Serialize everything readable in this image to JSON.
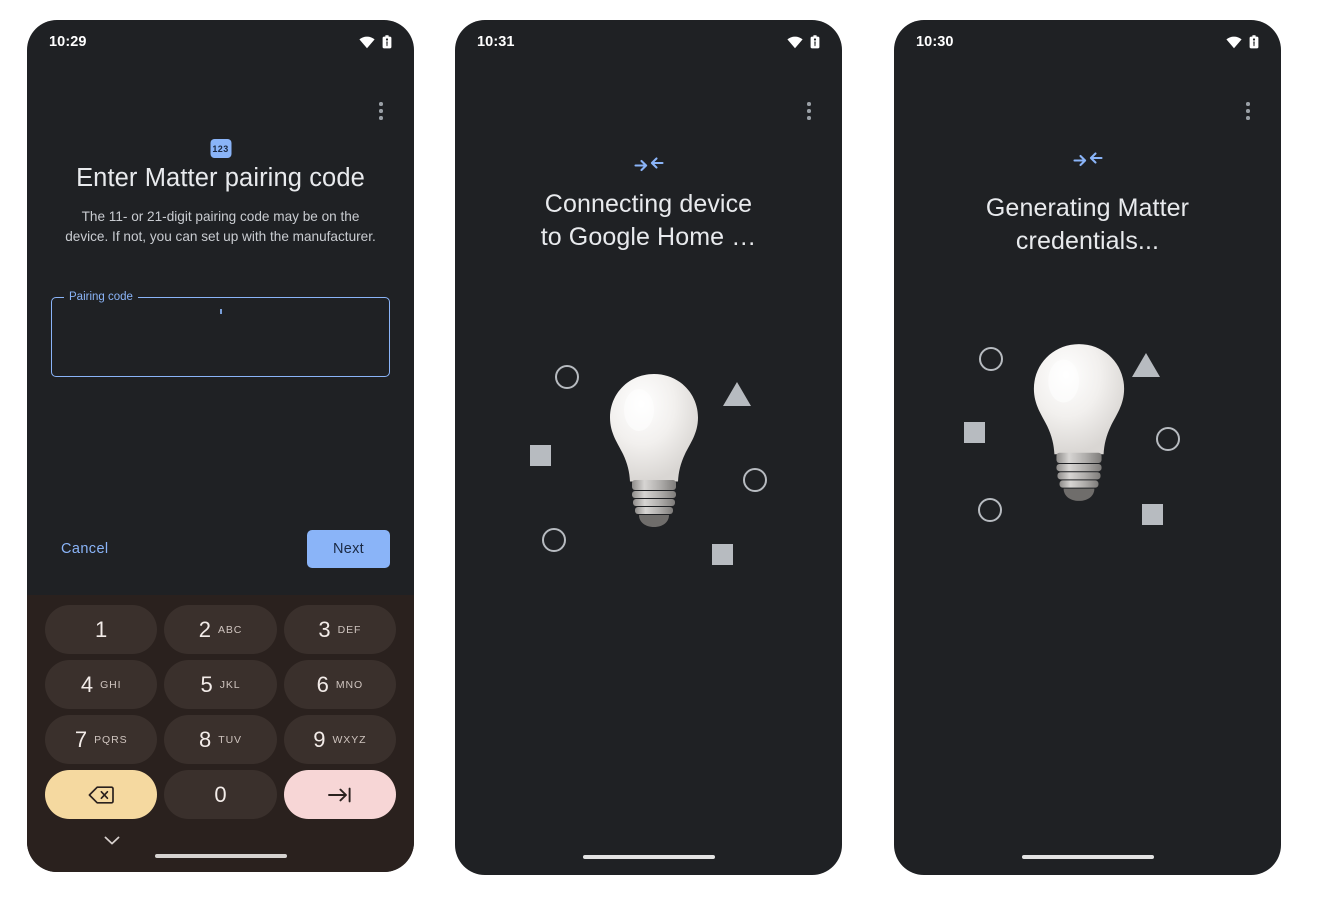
{
  "page": {
    "background": "#ffffff",
    "accent": "#8ab4f8"
  },
  "phones": [
    {
      "id": "phone1",
      "status": {
        "time": "10:29",
        "wifi_icon": "wifi-icon",
        "battery_icon": "battery-icon"
      },
      "overflow_icon": "more-vert-icon",
      "badge": {
        "icon": "numeric-123-icon",
        "label": "123",
        "color": "#8ab4f8"
      },
      "title": "Enter Matter pairing code",
      "description": "The 11- or 21-digit pairing code may be on the device. If not, you can set up with the manufacturer.",
      "field": {
        "label": "Pairing code",
        "value": "",
        "placeholder": ""
      },
      "buttons": {
        "cancel": "Cancel",
        "next": "Next"
      },
      "keyboard": {
        "collapse_icon": "chevron-down-icon",
        "keys": [
          {
            "num": "1",
            "letters": "",
            "name": "key-1",
            "kind": "num"
          },
          {
            "num": "2",
            "letters": "ABC",
            "name": "key-2",
            "kind": "num"
          },
          {
            "num": "3",
            "letters": "DEF",
            "name": "key-3",
            "kind": "num"
          },
          {
            "num": "4",
            "letters": "GHI",
            "name": "key-4",
            "kind": "num"
          },
          {
            "num": "5",
            "letters": "JKL",
            "name": "key-5",
            "kind": "num"
          },
          {
            "num": "6",
            "letters": "MNO",
            "name": "key-6",
            "kind": "num"
          },
          {
            "num": "7",
            "letters": "PQRS",
            "name": "key-7",
            "kind": "num"
          },
          {
            "num": "8",
            "letters": "TUV",
            "name": "key-8",
            "kind": "num"
          },
          {
            "num": "9",
            "letters": "WXYZ",
            "name": "key-9",
            "kind": "num"
          },
          {
            "num": "",
            "letters": "",
            "name": "key-backspace",
            "kind": "del",
            "icon": "backspace-icon",
            "color": "#f5d9a0"
          },
          {
            "num": "0",
            "letters": "",
            "name": "key-0",
            "kind": "num"
          },
          {
            "num": "",
            "letters": "",
            "name": "key-enter",
            "kind": "ent",
            "icon": "tab-next-icon",
            "color": "#f7d6d6"
          }
        ]
      }
    },
    {
      "id": "phone2",
      "status": {
        "time": "10:31",
        "wifi_icon": "wifi-icon",
        "battery_icon": "battery-icon"
      },
      "overflow_icon": "more-vert-icon",
      "link_icon": "connect-arrows-icon",
      "title_line1": "Connecting device",
      "title_line2": "to Google Home …",
      "illustration": "lightbulb-illustration"
    },
    {
      "id": "phone3",
      "status": {
        "time": "10:30",
        "wifi_icon": "wifi-icon",
        "battery_icon": "battery-icon"
      },
      "overflow_icon": "more-vert-icon",
      "link_icon": "connect-arrows-icon",
      "title_line1": "Generating Matter credentials...",
      "title_line2": "",
      "illustration": "lightbulb-illustration"
    }
  ]
}
